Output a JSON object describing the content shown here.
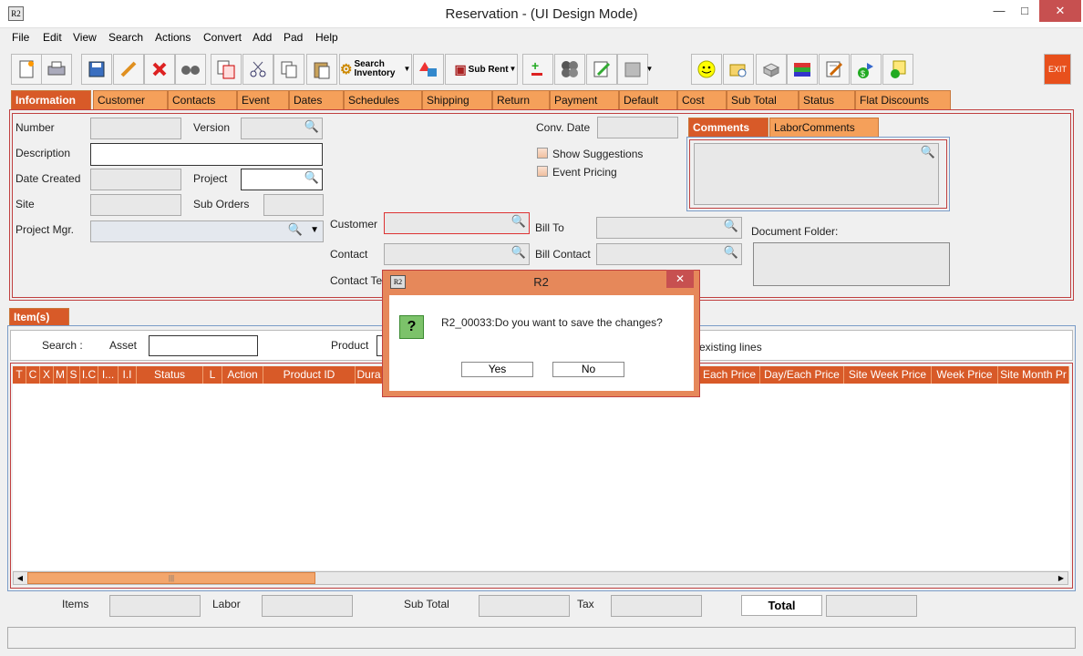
{
  "window": {
    "title": "Reservation - (UI Design Mode)",
    "icon_text": "R2"
  },
  "menu": [
    "File",
    "Edit",
    "View",
    "Search",
    "Actions",
    "Convert",
    "Add",
    "Pad",
    "Help"
  ],
  "toolbar": {
    "search_inventory": "Search Inventory",
    "sub_rent": "Sub Rent",
    "exit": "EXIT"
  },
  "tabs": [
    "Information",
    "Customer",
    "Contacts",
    "Event",
    "Dates",
    "Schedules",
    "Shipping",
    "Return",
    "Payment",
    "Default",
    "Cost",
    "Sub Total",
    "Status",
    "Flat Discounts"
  ],
  "info": {
    "number": "Number",
    "version": "Version",
    "description": "Description",
    "date_created": "Date Created",
    "project": "Project",
    "site": "Site",
    "sub_orders": "Sub Orders",
    "project_mgr": "Project Mgr.",
    "customer": "Customer",
    "contact": "Contact",
    "contact_tel": "Contact Te",
    "conv_date": "Conv. Date",
    "show_suggestions": "Show Suggestions",
    "event_pricing": "Event Pricing",
    "bill_to": "Bill To",
    "bill_contact": "Bill Contact",
    "document_folder": "Document Folder:"
  },
  "comment_tabs": [
    "Comments",
    "LaborComments"
  ],
  "items": {
    "tab": "Item(s)",
    "search": "Search :",
    "asset": "Asset",
    "product": "Product",
    "existing_lines": "existing lines",
    "columns_left": [
      "T",
      "C",
      "X",
      "M",
      "S",
      "I.C",
      "I...",
      "I.I",
      "Status",
      "L",
      "Action",
      "Product ID",
      "Dura"
    ],
    "columns_right": [
      "Each Price",
      "Day/Each Price",
      "Site Week Price",
      "Week Price",
      "Site Month Pr"
    ]
  },
  "totals": {
    "items": "Items",
    "labor": "Labor",
    "sub_total": "Sub Total",
    "tax": "Tax",
    "total": "Total"
  },
  "dialog": {
    "title": "R2",
    "icon_text": "R2",
    "message": "R2_00033:Do you want to save the changes?",
    "yes": "Yes",
    "no": "No",
    "question": "?"
  }
}
